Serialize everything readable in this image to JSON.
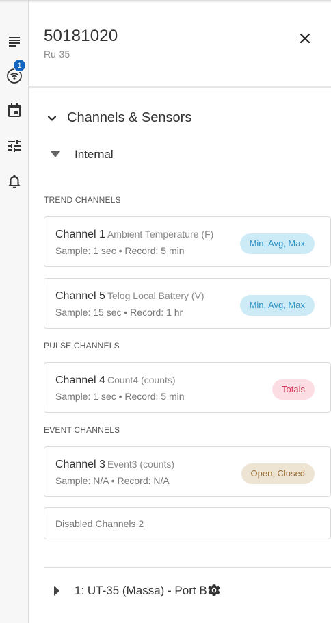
{
  "header": {
    "title": "50181020",
    "subtitle": "Ru-35"
  },
  "rail": {
    "notification_count": "1",
    "icons": [
      "list-icon",
      "wifi-icon",
      "calendar-icon",
      "sliders-icon",
      "bell-icon"
    ]
  },
  "section": {
    "title": "Channels & Sensors",
    "internal_label": "Internal"
  },
  "groups": {
    "trend": "TREND CHANNELS",
    "pulse": "PULSE CHANNELS",
    "event": "EVENT CHANNELS"
  },
  "channels": [
    {
      "name": "Channel 1",
      "desc": "Ambient Temperature (F)",
      "sample": "Sample: 1 sec • Record: 5 min",
      "chip": "Min, Avg, Max"
    },
    {
      "name": "Channel 5",
      "desc": "Telog Local Battery (V)",
      "sample": "Sample: 15 sec • Record: 1 hr",
      "chip": "Min, Avg, Max"
    },
    {
      "name": "Channel 4",
      "desc": "Count4 (counts)",
      "sample": "Sample: 1 sec • Record: 5 min",
      "chip": "Totals"
    },
    {
      "name": "Channel 3",
      "desc": "Event3 (counts)",
      "sample": "Sample: N/A • Record: N/A",
      "chip": "Open, Closed"
    }
  ],
  "disabled_label": "Disabled Channels 2",
  "port": {
    "label": "1: UT-35 (Massa) - Port B"
  },
  "colors": {
    "accent": "#1565c0",
    "chip_blue_bg": "#cdeaf7",
    "chip_blue_text": "#2a8fc4",
    "chip_pink_bg": "#fbdde3",
    "chip_pink_text": "#d23a57",
    "chip_tan_bg": "#eee4d4",
    "chip_tan_text": "#9a7038"
  }
}
